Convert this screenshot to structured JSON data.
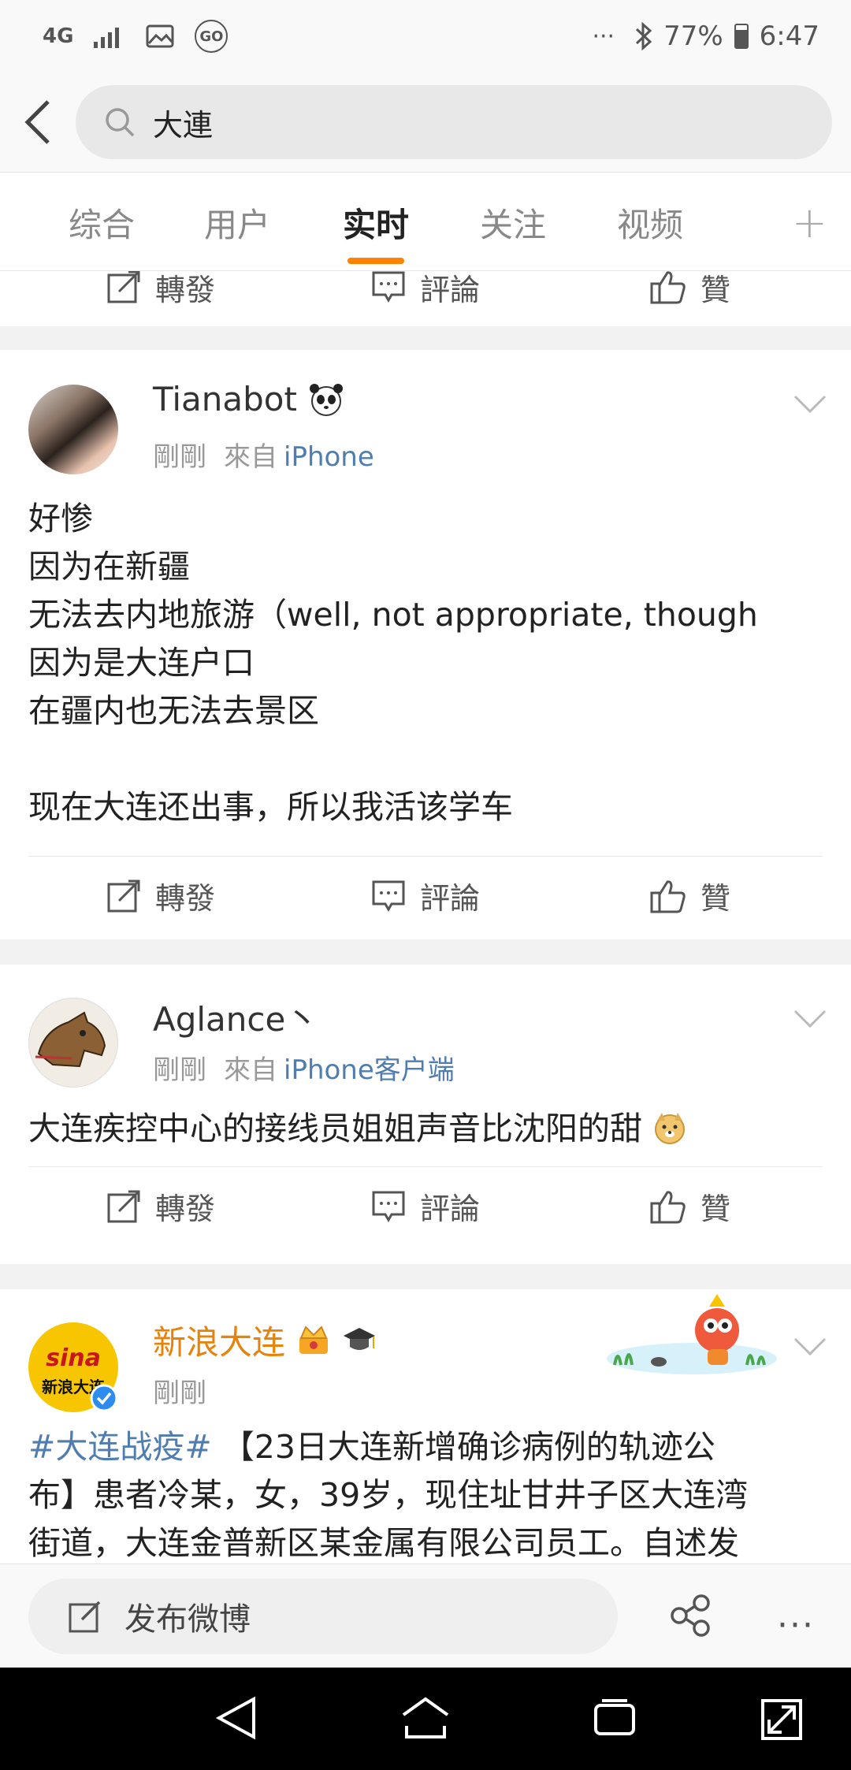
{
  "status_bar": {
    "network": "4G",
    "dots": "···",
    "battery": "77%",
    "battery_level": 0.77,
    "time": "6:47",
    "go_badge": "GO"
  },
  "search": {
    "query": "大連"
  },
  "tabs": [
    {
      "label": "综合",
      "active": false
    },
    {
      "label": "用户",
      "active": false
    },
    {
      "label": "实时",
      "active": true
    },
    {
      "label": "关注",
      "active": false
    },
    {
      "label": "视频",
      "active": false
    }
  ],
  "tab_add_label": "+",
  "actions": {
    "repost": "轉發",
    "comment": "評論",
    "like": "贊"
  },
  "posts": [
    {
      "username": "Tianabot",
      "badge_icon": "panda-icon",
      "time": "剛剛",
      "from_label": "來自",
      "source": "iPhone",
      "lines": [
        "好惨",
        "因为在新疆",
        "无法去内地旅游（well, not appropriate, though",
        "因为是大连户口",
        "在疆内也无法去景区",
        "",
        "现在大连还出事，所以我活该学车"
      ]
    },
    {
      "username": "Aglance丶",
      "time": "剛剛",
      "from_label": "來自",
      "source": "iPhone客户端",
      "lines": [
        "大连疾控中心的接线员姐姐声音比沈阳的甜"
      ],
      "emoji_icon": "doge-emoji-icon"
    },
    {
      "username": "新浪大连",
      "badge_icons": [
        "crown-vip-icon",
        "graduation-cap-icon"
      ],
      "time": "剛剛",
      "avatar_text": "sina",
      "avatar_subtext": "新浪大连",
      "hashtag": "#大连战疫#",
      "lines": [
        "【23日大连新增确诊病例的轨迹公",
        "布】患者冷某，女，39岁，现住址甘井子区大连湾",
        "街道，大连金普新区某金属有限公司员工。自述发"
      ]
    }
  ],
  "compose": {
    "label": "发布微博"
  },
  "colors": {
    "accent": "#ff8200",
    "link": "#507daf",
    "vip_name": "#e8830a"
  }
}
